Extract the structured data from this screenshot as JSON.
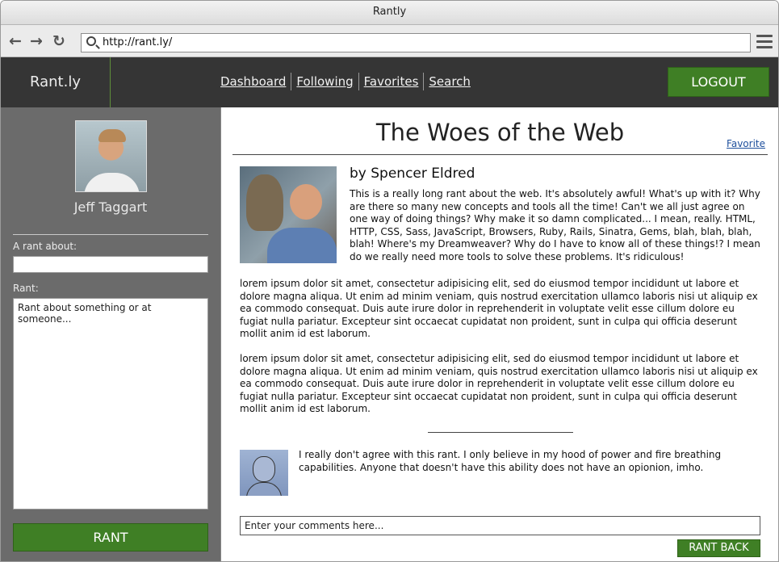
{
  "window": {
    "title": "Rantly"
  },
  "browser": {
    "url": "http://rant.ly/"
  },
  "header": {
    "brand": "Rant.ly",
    "nav": [
      "Dashboard",
      "Following",
      "Favorites",
      "Search"
    ],
    "logout_label": "LOGOUT"
  },
  "sidebar": {
    "user_name": "Jeff Taggart",
    "about_label": "A rant about:",
    "about_value": "",
    "rant_label": "Rant:",
    "rant_placeholder": "Rant about something or at someone...",
    "submit_label": "RANT"
  },
  "post": {
    "title": "The Woes of the Web",
    "favorite_label": "Favorite",
    "byline": "by Spencer Eldred",
    "intro": "This is a really long rant about the web. It's absolutely awful! What's up with it? Why are there so many new concepts and tools all the time! Can't we all just agree on one way of doing things? Why make it so damn complicated... I mean, really. HTML, HTTP, CSS, Sass, JavaScript, Browsers, Ruby, Rails, Sinatra, Gems, blah, blah, blah, blah! Where's my Dreamweaver? Why do I have to know all of these things!? I mean do we really need more tools to solve these problems. It's ridiculous!",
    "paragraphs": [
      "lorem ipsum dolor sit amet, consectetur adipisicing elit, sed do eiusmod tempor incididunt ut labore et dolore magna aliqua. Ut enim ad minim veniam, quis nostrud exercitation ullamco laboris nisi ut aliquip ex ea commodo consequat. Duis aute irure dolor in reprehenderit in voluptate velit esse cillum dolore eu fugiat nulla pariatur. Excepteur sint occaecat cupidatat non proident, sunt in culpa qui officia deserunt mollit anim id est laborum.",
      "lorem ipsum dolor sit amet, consectetur adipisicing elit, sed do eiusmod tempor incididunt ut labore et dolore magna aliqua. Ut enim ad minim veniam, quis nostrud exercitation ullamco laboris nisi ut aliquip ex ea commodo consequat. Duis aute irure dolor in reprehenderit in voluptate velit esse cillum dolore eu fugiat nulla pariatur. Excepteur sint occaecat cupidatat non proident, sunt in culpa qui officia deserunt mollit anim id est laborum."
    ]
  },
  "comments": [
    {
      "text": "I really don't agree with this rant. I only believe in my hood of power and fire breathing capabilities. Anyone that doesn't have this ability does not have an opionion, imho."
    }
  ],
  "comment_form": {
    "placeholder": "Enter your comments here...",
    "submit_label": "RANT BACK"
  },
  "colors": {
    "accent": "#3f7f25",
    "header_bg": "#353535",
    "sidebar_bg": "#6b6b6b"
  }
}
